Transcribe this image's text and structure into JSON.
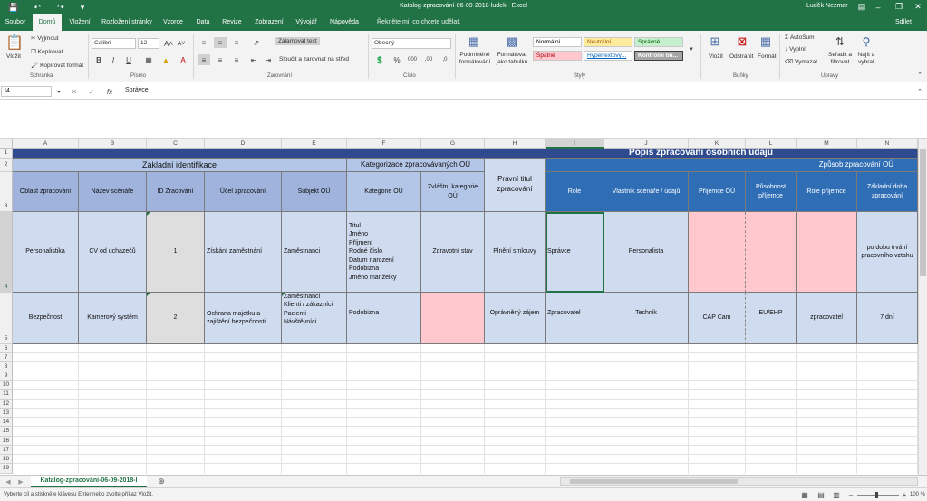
{
  "titlebar": {
    "window_title": "Katalog-zpracování-06-09-2018-ludek  -  Excel",
    "user": "Luděk Nezmar",
    "accent": "#217346"
  },
  "ribbon_tabs": [
    "Soubor",
    "Domů",
    "Vložení",
    "Rozložení stránky",
    "Vzorce",
    "Data",
    "Revize",
    "Zobrazení",
    "Vývojář",
    "Nápověda"
  ],
  "active_tab": "Domů",
  "tell_me": "Řekněte mi, co chcete udělat.",
  "share": "Sdílet",
  "ribbon": {
    "clipboard": {
      "paste": "Vložit",
      "cut": "Vyjmout",
      "copy": "Kopírovat",
      "format_painter": "Kopírovat formát",
      "group": "Schránka"
    },
    "font": {
      "name": "Calibri",
      "size": "12",
      "group": "Písmo"
    },
    "alignment": {
      "wrap": "Zalamovat text",
      "merge": "Sloučit a zarovnat na střed",
      "group": "Zarovnání"
    },
    "number": {
      "format": "Obecný",
      "group": "Číslo"
    },
    "styles": {
      "conditional": [
        "Podmíněné",
        "formátování"
      ],
      "as_table": [
        "Formátovat",
        "jako tabulku"
      ],
      "cells": [
        {
          "label": "Normální",
          "bg": "#ffffff",
          "fg": "#000000"
        },
        {
          "label": "Neutrální",
          "bg": "#ffeb9c",
          "fg": "#9c5700"
        },
        {
          "label": "Správně",
          "bg": "#c6efce",
          "fg": "#006100"
        },
        {
          "label": "Špatně",
          "bg": "#ffc7ce",
          "fg": "#9c0006"
        },
        {
          "label": "Hypertextový...",
          "bg": "#ffffff",
          "fg": "#0563c1"
        },
        {
          "label": "Kontrolní bu...",
          "bg": "#a5a5a5",
          "fg": "#ffffff"
        }
      ],
      "group": "Styly"
    },
    "cells": {
      "insert": "Vložit",
      "delete": "Odstranit",
      "format": "Formát",
      "group": "Buňky"
    },
    "editing": {
      "autosum": "AutoSum",
      "fill": "Vyplnit",
      "clear": "Vymazat",
      "sort": [
        "Seřadit a",
        "filtrovat"
      ],
      "find": [
        "Najít a",
        "vybrat"
      ],
      "group": "Úpravy"
    }
  },
  "formula_bar": {
    "name_box": "I4",
    "value": "Správce"
  },
  "columns": [
    "A",
    "B",
    "C",
    "D",
    "E",
    "F",
    "G",
    "H",
    "I",
    "J",
    "K",
    "L",
    "M",
    "N"
  ],
  "selected_column": "I",
  "rows": [
    "1",
    "2",
    "3",
    "4",
    "5",
    "6",
    "7",
    "8",
    "9",
    "10",
    "11",
    "12",
    "13",
    "14",
    "15",
    "16",
    "17",
    "18",
    "19"
  ],
  "sheet": {
    "title": "Popis zpracování osobních údajů",
    "group_basic": "Základní identifikace",
    "group_categories": "Kategorizace zpracovávaných OÚ",
    "group_method": "Způsob zpracování OÚ",
    "headers": {
      "a": "Oblast zpracování",
      "b": "Název scénáře",
      "c": "ID Zracování",
      "d": "Účel zpracování",
      "e": "Subjekt OÚ",
      "f": "Kategorie OÚ",
      "g": [
        "Zvláštní kategorie",
        "OÚ"
      ],
      "h": [
        "Právní  titul",
        "zpracování"
      ],
      "i": "Role",
      "j": "Vlastník scénáře / údajů",
      "k": "Příjemce OÚ",
      "l": [
        "Působnost",
        "příjemce"
      ],
      "m": "Role příjemce",
      "n": [
        "Základní doba",
        "zpracování"
      ]
    },
    "row4": {
      "a": "Personalistika",
      "b": "CV od uchazečů",
      "c": "1",
      "d": "Získání zaměstnání",
      "e": "Zaměstnanci",
      "f": [
        "Titul",
        "Jméno",
        "Příjmení",
        "Rodné číslo",
        "Datum narození",
        "Podobizna",
        "Jméno manželky"
      ],
      "g": "Zdravotní stav",
      "h": "Plnění smlouvy",
      "i": "Správce",
      "j": "Personalista",
      "k": "",
      "l": "",
      "m": "",
      "n": [
        "po dobu trvání",
        "pracovního vztahu"
      ]
    },
    "row5": {
      "a": "Bezpečnost",
      "b": "Kamerový systém",
      "c": "2",
      "d": [
        "Ochrana majetku a",
        "zajištění bezpečnosti"
      ],
      "e": [
        "Zaměstnanci",
        "Klienti / zákazníci",
        "Pacienti",
        "Návštěvníci"
      ],
      "f": "Podobizna",
      "g": "",
      "h": "Oprávněný zájem",
      "i": "Zpracovatel",
      "j": "Technik",
      "k": "CAP Cam",
      "l": "EU/EHP",
      "m": "zpracovatel",
      "n": "7 dní"
    }
  },
  "sheet_tab": "Katalog-zpracování-06-09-2018-l",
  "status": {
    "message": "Vyberte cíl a stiskněte klávesu Enter nebo zvolte příkaz Vložit.",
    "zoom": "100 %"
  }
}
